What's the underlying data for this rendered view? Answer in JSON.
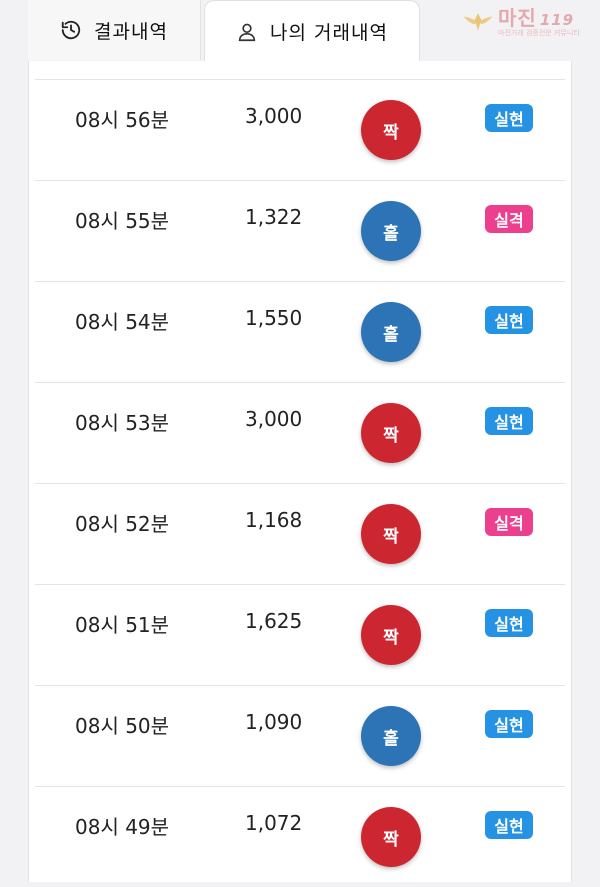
{
  "tabs": [
    {
      "label": "결과내역",
      "icon": "history-icon"
    },
    {
      "label": "나의 거래내역",
      "icon": "user-icon"
    }
  ],
  "watermark": {
    "brand": "마진",
    "suffix": "119",
    "sub": "마진거래 검증전문 커뮤니티"
  },
  "colors": {
    "red_ball": "#cc2730",
    "blue_ball": "#2d74b6",
    "badge_hit": "#2592e4",
    "badge_miss": "#ec3f8e"
  },
  "records": [
    {
      "time": "08시 56분",
      "amount": "3,000",
      "pick": "짝",
      "pick_color": "red",
      "result": "실현",
      "result_type": "hit"
    },
    {
      "time": "08시 55분",
      "amount": "1,322",
      "pick": "홀",
      "pick_color": "blue",
      "result": "실격",
      "result_type": "miss"
    },
    {
      "time": "08시 54분",
      "amount": "1,550",
      "pick": "홀",
      "pick_color": "blue",
      "result": "실현",
      "result_type": "hit"
    },
    {
      "time": "08시 53분",
      "amount": "3,000",
      "pick": "짝",
      "pick_color": "red",
      "result": "실현",
      "result_type": "hit"
    },
    {
      "time": "08시 52분",
      "amount": "1,168",
      "pick": "짝",
      "pick_color": "red",
      "result": "실격",
      "result_type": "miss"
    },
    {
      "time": "08시 51분",
      "amount": "1,625",
      "pick": "짝",
      "pick_color": "red",
      "result": "실현",
      "result_type": "hit"
    },
    {
      "time": "08시 50분",
      "amount": "1,090",
      "pick": "홀",
      "pick_color": "blue",
      "result": "실현",
      "result_type": "hit"
    },
    {
      "time": "08시 49분",
      "amount": "1,072",
      "pick": "짝",
      "pick_color": "red",
      "result": "실현",
      "result_type": "hit"
    }
  ]
}
